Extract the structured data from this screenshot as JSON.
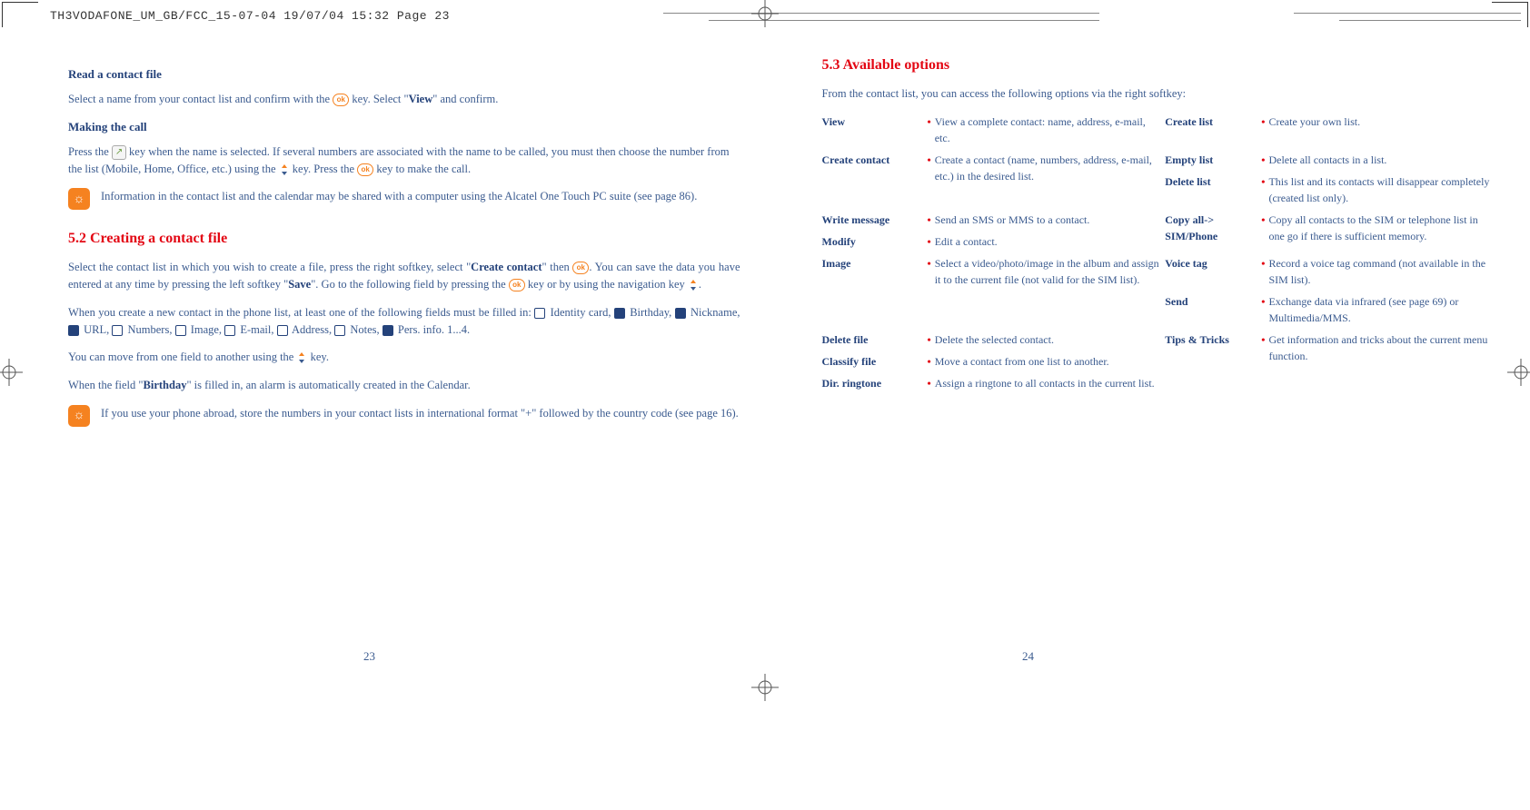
{
  "header": "TH3VODAFONE_UM_GB/FCC_15-07-04  19/07/04  15:32  Page 23",
  "left": {
    "h1": "Read a contact file",
    "p1a": "Select a name from your contact list and confirm with the ",
    "p1b": " key. Select \"",
    "p1c": "View",
    "p1d": "\" and confirm.",
    "h2": "Making the call",
    "p2a": "Press the ",
    "p2b": " key when the name is selected. If several numbers are associated with the name to be called, you must then choose the number from the list (Mobile, Home, Office, etc.) using the ",
    "p2c": " key. Press the ",
    "p2d": " key to make the call.",
    "note1": "Information in the contact list and the calendar may be shared with a computer using the Alcatel One Touch PC suite (see page 86).",
    "sec52num": "5.2",
    "sec52title": " Creating a contact file",
    "p3a": "Select the contact list in which you wish to create a file, press the right softkey, select \"",
    "p3b": "Create contact",
    "p3c": "\" then ",
    "p3d": ". You can save the data you have entered at any time by pressing the left softkey \"",
    "p3e": "Save",
    "p3f": "\". Go to the following field by pressing the ",
    "p3g": " key or by using the navigation key ",
    "p3h": ".",
    "p4a": "When you create a new contact in the phone list, at least one of the following fields must be filled in: ",
    "f_identity": " Identity card, ",
    "f_birthday": " Birthday, ",
    "f_nickname": " Nickname, ",
    "f_url": " URL, ",
    "f_numbers": " Numbers, ",
    "f_image": " Image, ",
    "f_email": " E-mail, ",
    "f_address": " Address, ",
    "f_notes": " Notes, ",
    "f_pers": " Pers. info. 1...4.",
    "p5a": "You can move from one field to another using the ",
    "p5b": " key.",
    "p6a": "When the field \"",
    "p6b": "Birthday",
    "p6c": "\" is filled in, an alarm is automatically created in the Calendar.",
    "note2": "If you use your phone abroad, store the numbers in your contact lists in international format \"+\" followed by the country code (see page 16).",
    "pagenum": "23"
  },
  "right": {
    "sec53num": "5.3",
    "sec53title": " Available options",
    "intro": "From the contact list, you can access the following options via the right softkey:",
    "opts": {
      "view_t": "View",
      "view_d": "View a complete contact: name, address, e-mail, etc.",
      "createc_t": "Create contact",
      "createc_d": "Create a contact (name, numbers, address, e-mail, etc.) in the desired list.",
      "write_t": "Write message",
      "write_d": "Send an SMS or MMS to a contact.",
      "modify_t": "Modify",
      "modify_d": "Edit a contact.",
      "image_t": "Image",
      "image_d": "Select a video/photo/image in the album and assign it to the current file (not valid for the SIM list).",
      "delf_t": "Delete file",
      "delf_d": "Delete the selected contact.",
      "clas_t": "Classify file",
      "clas_d": "Move a contact from one list to another.",
      "dir_t": "Dir. ringtone",
      "dir_d": "Assign a ringtone to all contacts in the current list.",
      "crl_t": "Create list",
      "crl_d": "Create your own list.",
      "emp_t": "Empty list",
      "emp_d": "Delete all contacts in a list.",
      "dell_t": "Delete list",
      "dell_d": "This list and its contacts will disappear completely (created list only).",
      "copy_t": "Copy all-> SIM/Phone",
      "copy_d": "Copy all contacts to the SIM or telephone list in one go if there is sufficient memory.",
      "voice_t": "Voice tag",
      "voice_d": "Record a voice tag command (not available in the SIM list).",
      "send_t": "Send",
      "send_d": "Exchange data via infrared (see page 69) or Multimedia/MMS.",
      "tips_t": "Tips & Tricks",
      "tips_d": "Get information and tricks about the current menu function."
    },
    "pagenum": "24"
  }
}
